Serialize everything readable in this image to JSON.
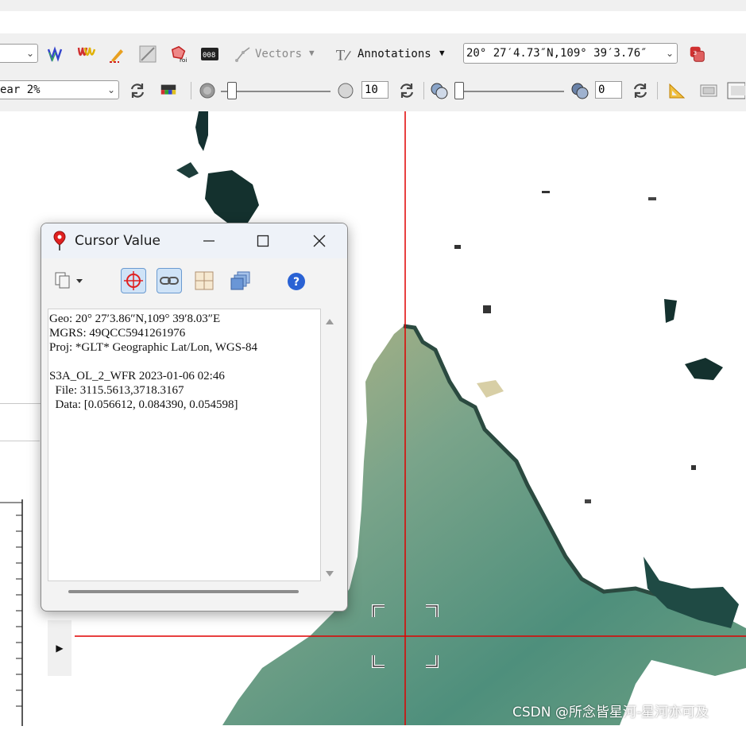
{
  "toolbar": {
    "row1": {
      "left_combo_value": "",
      "vectors_label": "Vectors",
      "annotations_label": "Annotations",
      "location_value": "20° 27′4.73″N,109° 39′3.76″",
      "icons": [
        "spectral-profile-icon",
        "spectral-plot-icon",
        "pencil-profile-icon",
        "arbitrary-profile-icon",
        "roi-tool-icon",
        "dataset-id-icon",
        "vectors-icon",
        "annotations-icon",
        "layer-manager-icon"
      ]
    },
    "row2": {
      "stretch_value": "ear 2%",
      "brightness_value": "10",
      "transparency_value": "0",
      "icons": [
        "refresh-icon",
        "color-table-icon",
        "brightness-icon",
        "contrast-icon",
        "transparency-icon",
        "measure-icon",
        "overview-icon"
      ]
    }
  },
  "cursor_window": {
    "title": "Cursor Value",
    "tool_icons": [
      "copy-icon",
      "crosshair-icon",
      "link-icon",
      "grid-icon",
      "layers-icon",
      "help-icon"
    ],
    "lines": [
      "Geo: 20° 27′3.86″N,109° 39′8.03″E",
      "MGRS: 49QCC5941261976",
      "Proj: *GLT* Geographic Lat/Lon, WGS-84",
      "",
      "S3A_OL_2_WFR 2023-01-06 02:46",
      "  File: 3115.5613,3718.3167",
      "  Data: [0.056612, 0.084390, 0.054598]"
    ]
  },
  "watermark": "CSDN @所念皆星河-星河亦可及",
  "colors": {
    "crosshair": "#e00000",
    "water_green": "#4e8f7c",
    "water_yellow": "#b9b583",
    "coast_dark": "#14312e",
    "toolbar_bg": "#f0f0f0"
  }
}
